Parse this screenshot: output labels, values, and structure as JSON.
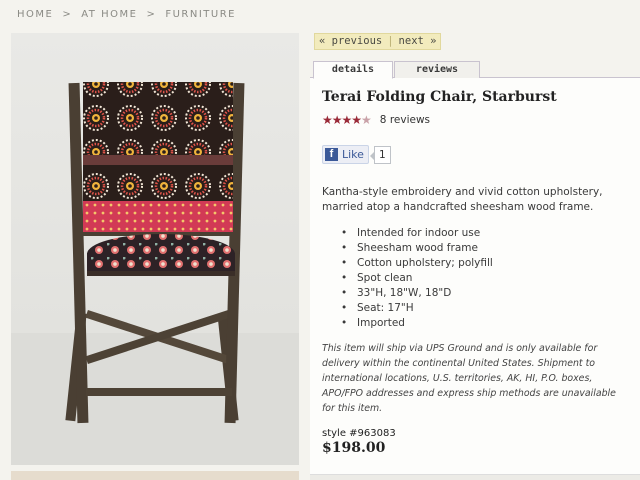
{
  "breadcrumb": {
    "items": [
      "HOME",
      "AT HOME",
      "FURNITURE"
    ],
    "separator": ">"
  },
  "product_image": {
    "alt": "Terai Folding Chair, Starburst",
    "colors": {
      "wood": "#4a3f33",
      "fabric_dark": "#2a1e1a",
      "fabric_pink": "#d23a55",
      "floor": "#dcdcd8"
    }
  },
  "nav": {
    "previous": "« previous",
    "divider": "|",
    "next": "next »"
  },
  "tabs": [
    {
      "label": "details",
      "active": true
    },
    {
      "label": "reviews",
      "active": false
    }
  ],
  "product": {
    "title": "Terai Folding Chair, Starburst",
    "rating": 4.5,
    "stars_full": "★★★★",
    "stars_half": "★",
    "review_count": "8 reviews",
    "like_label": "Like",
    "like_icon": "f",
    "like_count": "1",
    "description": "Kantha-style embroidery and vivid cotton upholstery, married atop a handcrafted sheesham wood frame.",
    "features": [
      "Intended for indoor use",
      "Sheesham wood frame",
      "Cotton upholstery; polyfill",
      "Spot clean",
      "33\"H, 18\"W, 18\"D",
      "Seat: 17\"H",
      "Imported"
    ],
    "shipping_note": "This item will ship via UPS Ground and is only available for delivery within the continental United States. Shipment to international locations, U.S. territories, AK, HI, P.O. boxes, APO/FPO addresses and express ship methods are unavailable for this item.",
    "style_number": "style #963083",
    "price": "$198.00"
  },
  "colors": {
    "accent_star": "#9a2a38",
    "facebook_blue": "#3b5998",
    "prevnext_bg": "#f2ebbd"
  }
}
